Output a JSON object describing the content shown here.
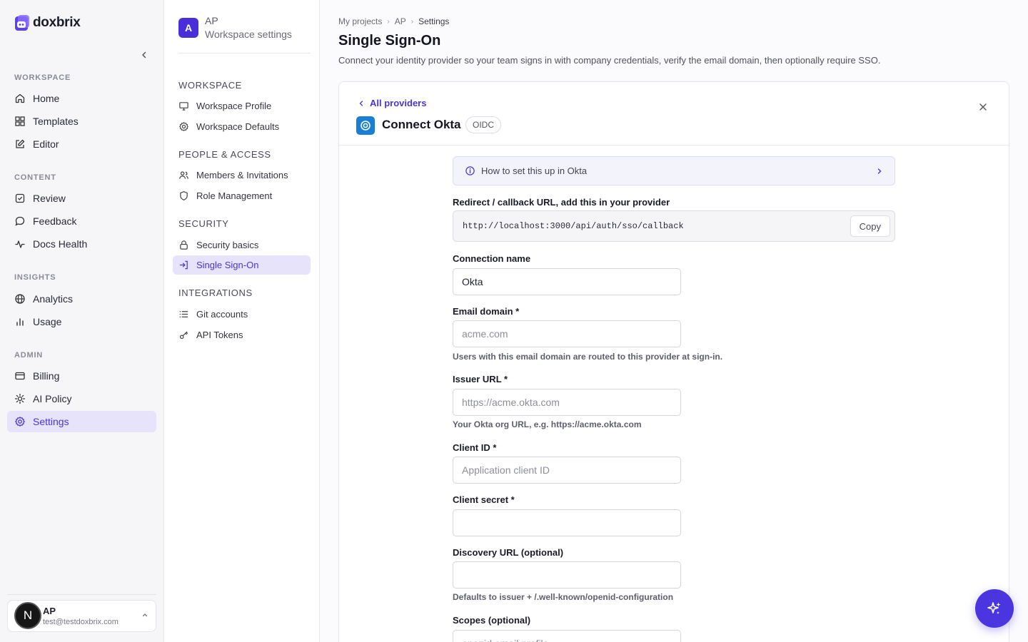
{
  "app": {
    "brand": "doxbrix",
    "accent": "#4a35d8"
  },
  "sidebar": {
    "sections": [
      {
        "title": "WORKSPACE",
        "items": [
          {
            "label": "Home",
            "icon": "home-icon"
          },
          {
            "label": "Templates",
            "icon": "templates-icon"
          },
          {
            "label": "Editor",
            "icon": "edit-icon"
          }
        ]
      },
      {
        "title": "CONTENT",
        "items": [
          {
            "label": "Review",
            "icon": "review-icon"
          },
          {
            "label": "Feedback",
            "icon": "feedback-icon"
          },
          {
            "label": "Docs Health",
            "icon": "pulse-icon"
          }
        ]
      },
      {
        "title": "INSIGHTS",
        "items": [
          {
            "label": "Analytics",
            "icon": "globe-icon"
          },
          {
            "label": "Usage",
            "icon": "bar-chart-icon"
          }
        ]
      },
      {
        "title": "ADMIN",
        "items": [
          {
            "label": "Billing",
            "icon": "card-icon"
          },
          {
            "label": "AI Policy",
            "icon": "sun-icon"
          },
          {
            "label": "Settings",
            "icon": "gear-icon",
            "active": true
          }
        ]
      }
    ],
    "user": {
      "initial": "N",
      "name": "AP",
      "email": "test@testdoxbrix.com"
    }
  },
  "subnav": {
    "workspace_initial": "A",
    "workspace_name": "AP",
    "workspace_sub": "Workspace settings",
    "sections": [
      {
        "title": "WORKSPACE",
        "items": [
          {
            "label": "Workspace Profile",
            "icon": "monitor-icon"
          },
          {
            "label": "Workspace Defaults",
            "icon": "gear-icon"
          }
        ]
      },
      {
        "title": "PEOPLE & ACCESS",
        "items": [
          {
            "label": "Members & Invitations",
            "icon": "users-icon"
          },
          {
            "label": "Role Management",
            "icon": "shield-icon"
          }
        ]
      },
      {
        "title": "SECURITY",
        "items": [
          {
            "label": "Security basics",
            "icon": "lock-icon"
          },
          {
            "label": "Single Sign-On",
            "icon": "sign-in-icon",
            "active": true
          }
        ]
      },
      {
        "title": "INTEGRATIONS",
        "items": [
          {
            "label": "Git accounts",
            "icon": "list-icon"
          },
          {
            "label": "API Tokens",
            "icon": "key-icon"
          }
        ]
      }
    ]
  },
  "main": {
    "breadcrumb": [
      "My projects",
      "AP",
      "Settings"
    ],
    "title": "Single Sign-On",
    "description": "Connect your identity provider so your team signs in with company credentials, verify the email domain, then optionally require SSO.",
    "card": {
      "back_label": "All providers",
      "heading": "Connect Okta",
      "badge": "OIDC",
      "howto": "How to set this up in Okta",
      "callback_label": "Redirect / callback URL, add this in your provider",
      "callback_url": "http://localhost:3000/api/auth/sso/callback",
      "copy_label": "Copy",
      "fields": {
        "connection_name": {
          "label": "Connection name",
          "value": "Okta",
          "placeholder": ""
        },
        "email_domain": {
          "label": "Email domain *",
          "value": "",
          "placeholder": "acme.com",
          "hint": "Users with this email domain are routed to this provider at sign-in."
        },
        "issuer_url": {
          "label": "Issuer URL *",
          "value": "",
          "placeholder": "https://acme.okta.com",
          "hint": "Your Okta org URL, e.g. https://acme.okta.com"
        },
        "client_id": {
          "label": "Client ID *",
          "value": "",
          "placeholder": "Application client ID"
        },
        "client_secret": {
          "label": "Client secret *",
          "value": "",
          "placeholder": ""
        },
        "discovery_url": {
          "label": "Discovery URL (optional)",
          "value": "",
          "placeholder": "",
          "hint": "Defaults to issuer + /.well-known/openid-configuration"
        },
        "scopes": {
          "label": "Scopes (optional)",
          "value": "",
          "placeholder": "openid email profile"
        }
      }
    }
  }
}
